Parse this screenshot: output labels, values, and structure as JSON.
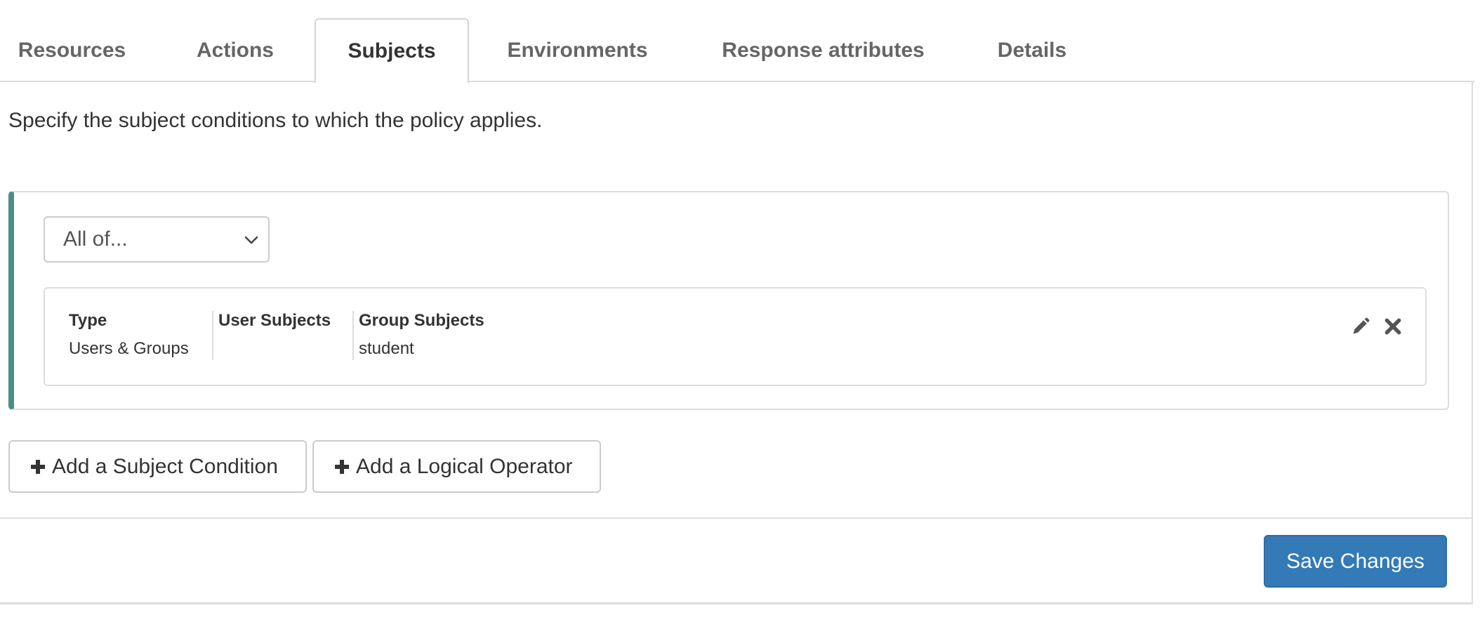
{
  "tabs": [
    {
      "label": "Resources",
      "active": false
    },
    {
      "label": "Actions",
      "active": false
    },
    {
      "label": "Subjects",
      "active": true
    },
    {
      "label": "Environments",
      "active": false
    },
    {
      "label": "Response attributes",
      "active": false
    },
    {
      "label": "Details",
      "active": false
    }
  ],
  "intro_text": "Specify the subject conditions to which the policy applies.",
  "condition": {
    "accent_color": "#4a8f81",
    "operator": {
      "selected": "All of..."
    },
    "rule": {
      "columns": [
        {
          "header": "Type",
          "value": "Users & Groups"
        },
        {
          "header": "User Subjects",
          "value": ""
        },
        {
          "header": "Group Subjects",
          "value": "student"
        }
      ],
      "icons": [
        "pencil-icon",
        "close-icon"
      ]
    }
  },
  "buttons": {
    "add_subject_condition": "Add a Subject Condition",
    "add_logical_operator": "Add a Logical Operator",
    "save_changes": "Save Changes"
  },
  "colors": {
    "primary": "#337ab7"
  }
}
